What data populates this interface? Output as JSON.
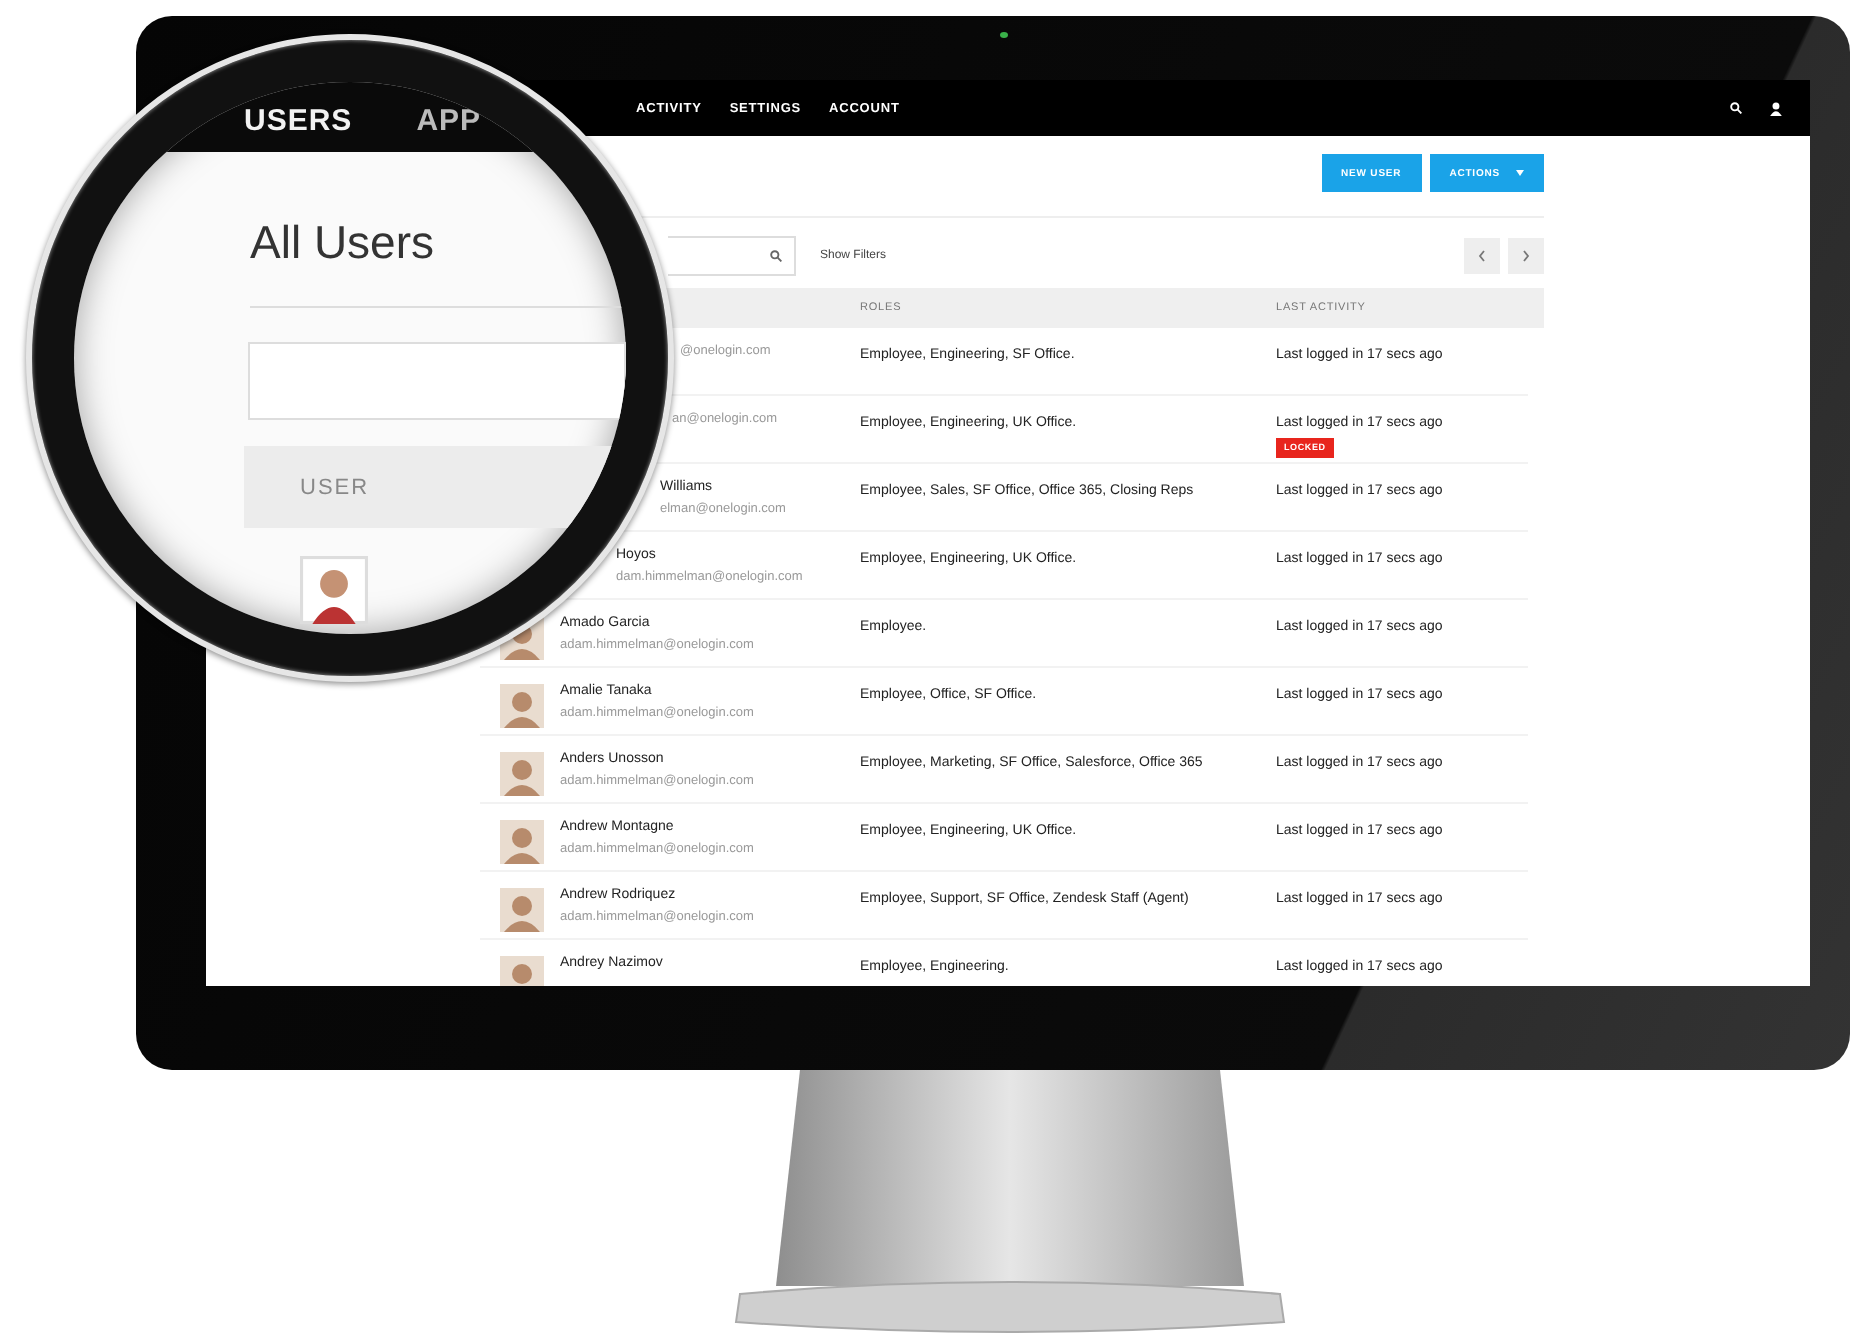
{
  "nav": {
    "items": [
      "ACTIVITY",
      "SETTINGS",
      "ACCOUNT"
    ]
  },
  "toolbar": {
    "new_user": "NEW USER",
    "actions": "ACTIONS",
    "show_filters": "Show Filters"
  },
  "table": {
    "columns": [
      "ROLES",
      "LAST ACTIVITY"
    ],
    "rows": [
      {
        "email": "@onelogin.com",
        "roles": "Employee, Engineering, SF Office.",
        "last_activity": "Last logged in 17 secs ago"
      },
      {
        "email": "an@onelogin.com",
        "roles": "Employee, Engineering, UK Office.",
        "last_activity": "Last logged in 17 secs ago",
        "badge": "LOCKED"
      },
      {
        "name": "Williams",
        "email": "elman@onelogin.com",
        "roles": "Employee, Sales, SF Office, Office 365, Closing Reps",
        "last_activity": "Last logged in 17 secs ago"
      },
      {
        "name": "Hoyos",
        "email": "dam.himmelman@onelogin.com",
        "roles": "Employee, Engineering, UK Office.",
        "last_activity": "Last logged in 17 secs ago"
      },
      {
        "name": "Amado Garcia",
        "email": "adam.himmelman@onelogin.com",
        "roles": "Employee.",
        "last_activity": "Last logged in 17 secs ago"
      },
      {
        "name": "Amalie Tanaka",
        "email": "adam.himmelman@onelogin.com",
        "roles": "Employee, Office, SF Office.",
        "last_activity": "Last logged in 17 secs ago"
      },
      {
        "name": "Anders Unosson",
        "email": "adam.himmelman@onelogin.com",
        "roles": "Employee, Marketing, SF Office, Salesforce, Office 365",
        "last_activity": "Last logged in 17 secs ago"
      },
      {
        "name": "Andrew Montagne",
        "email": "adam.himmelman@onelogin.com",
        "roles": "Employee, Engineering, UK Office.",
        "last_activity": "Last logged in 17 secs ago"
      },
      {
        "name": "Andrew Rodriquez",
        "email": "adam.himmelman@onelogin.com",
        "roles": "Employee, Support, SF Office, Zendesk Staff (Agent)",
        "last_activity": "Last logged in 17 secs ago"
      },
      {
        "name": "Andrey Nazimov",
        "roles": "Employee, Engineering.",
        "last_activity": "Last logged in 17 secs ago"
      }
    ]
  },
  "magnifier": {
    "nav": [
      "USERS",
      "APP"
    ],
    "heading": "All Users",
    "column": "USER"
  }
}
